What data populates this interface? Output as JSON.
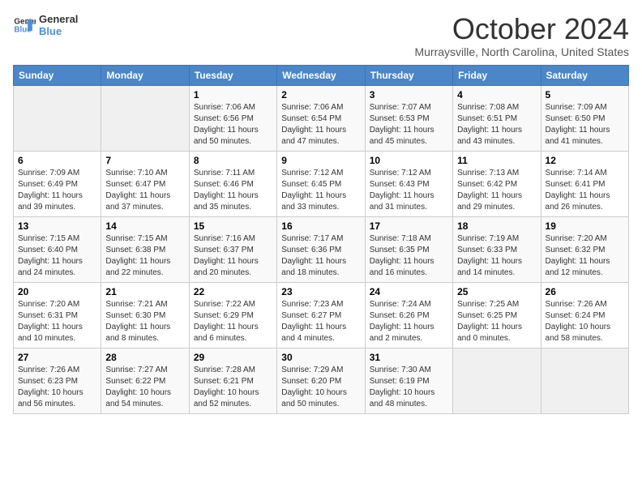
{
  "logo": {
    "line1": "General",
    "line2": "Blue"
  },
  "title": "October 2024",
  "location": "Murraysville, North Carolina, United States",
  "days_of_week": [
    "Sunday",
    "Monday",
    "Tuesday",
    "Wednesday",
    "Thursday",
    "Friday",
    "Saturday"
  ],
  "weeks": [
    [
      {
        "day": "",
        "empty": true
      },
      {
        "day": "",
        "empty": true
      },
      {
        "day": "1",
        "sunrise": "Sunrise: 7:06 AM",
        "sunset": "Sunset: 6:56 PM",
        "daylight": "Daylight: 11 hours and 50 minutes."
      },
      {
        "day": "2",
        "sunrise": "Sunrise: 7:06 AM",
        "sunset": "Sunset: 6:54 PM",
        "daylight": "Daylight: 11 hours and 47 minutes."
      },
      {
        "day": "3",
        "sunrise": "Sunrise: 7:07 AM",
        "sunset": "Sunset: 6:53 PM",
        "daylight": "Daylight: 11 hours and 45 minutes."
      },
      {
        "day": "4",
        "sunrise": "Sunrise: 7:08 AM",
        "sunset": "Sunset: 6:51 PM",
        "daylight": "Daylight: 11 hours and 43 minutes."
      },
      {
        "day": "5",
        "sunrise": "Sunrise: 7:09 AM",
        "sunset": "Sunset: 6:50 PM",
        "daylight": "Daylight: 11 hours and 41 minutes."
      }
    ],
    [
      {
        "day": "6",
        "sunrise": "Sunrise: 7:09 AM",
        "sunset": "Sunset: 6:49 PM",
        "daylight": "Daylight: 11 hours and 39 minutes."
      },
      {
        "day": "7",
        "sunrise": "Sunrise: 7:10 AM",
        "sunset": "Sunset: 6:47 PM",
        "daylight": "Daylight: 11 hours and 37 minutes."
      },
      {
        "day": "8",
        "sunrise": "Sunrise: 7:11 AM",
        "sunset": "Sunset: 6:46 PM",
        "daylight": "Daylight: 11 hours and 35 minutes."
      },
      {
        "day": "9",
        "sunrise": "Sunrise: 7:12 AM",
        "sunset": "Sunset: 6:45 PM",
        "daylight": "Daylight: 11 hours and 33 minutes."
      },
      {
        "day": "10",
        "sunrise": "Sunrise: 7:12 AM",
        "sunset": "Sunset: 6:43 PM",
        "daylight": "Daylight: 11 hours and 31 minutes."
      },
      {
        "day": "11",
        "sunrise": "Sunrise: 7:13 AM",
        "sunset": "Sunset: 6:42 PM",
        "daylight": "Daylight: 11 hours and 29 minutes."
      },
      {
        "day": "12",
        "sunrise": "Sunrise: 7:14 AM",
        "sunset": "Sunset: 6:41 PM",
        "daylight": "Daylight: 11 hours and 26 minutes."
      }
    ],
    [
      {
        "day": "13",
        "sunrise": "Sunrise: 7:15 AM",
        "sunset": "Sunset: 6:40 PM",
        "daylight": "Daylight: 11 hours and 24 minutes."
      },
      {
        "day": "14",
        "sunrise": "Sunrise: 7:15 AM",
        "sunset": "Sunset: 6:38 PM",
        "daylight": "Daylight: 11 hours and 22 minutes."
      },
      {
        "day": "15",
        "sunrise": "Sunrise: 7:16 AM",
        "sunset": "Sunset: 6:37 PM",
        "daylight": "Daylight: 11 hours and 20 minutes."
      },
      {
        "day": "16",
        "sunrise": "Sunrise: 7:17 AM",
        "sunset": "Sunset: 6:36 PM",
        "daylight": "Daylight: 11 hours and 18 minutes."
      },
      {
        "day": "17",
        "sunrise": "Sunrise: 7:18 AM",
        "sunset": "Sunset: 6:35 PM",
        "daylight": "Daylight: 11 hours and 16 minutes."
      },
      {
        "day": "18",
        "sunrise": "Sunrise: 7:19 AM",
        "sunset": "Sunset: 6:33 PM",
        "daylight": "Daylight: 11 hours and 14 minutes."
      },
      {
        "day": "19",
        "sunrise": "Sunrise: 7:20 AM",
        "sunset": "Sunset: 6:32 PM",
        "daylight": "Daylight: 11 hours and 12 minutes."
      }
    ],
    [
      {
        "day": "20",
        "sunrise": "Sunrise: 7:20 AM",
        "sunset": "Sunset: 6:31 PM",
        "daylight": "Daylight: 11 hours and 10 minutes."
      },
      {
        "day": "21",
        "sunrise": "Sunrise: 7:21 AM",
        "sunset": "Sunset: 6:30 PM",
        "daylight": "Daylight: 11 hours and 8 minutes."
      },
      {
        "day": "22",
        "sunrise": "Sunrise: 7:22 AM",
        "sunset": "Sunset: 6:29 PM",
        "daylight": "Daylight: 11 hours and 6 minutes."
      },
      {
        "day": "23",
        "sunrise": "Sunrise: 7:23 AM",
        "sunset": "Sunset: 6:27 PM",
        "daylight": "Daylight: 11 hours and 4 minutes."
      },
      {
        "day": "24",
        "sunrise": "Sunrise: 7:24 AM",
        "sunset": "Sunset: 6:26 PM",
        "daylight": "Daylight: 11 hours and 2 minutes."
      },
      {
        "day": "25",
        "sunrise": "Sunrise: 7:25 AM",
        "sunset": "Sunset: 6:25 PM",
        "daylight": "Daylight: 11 hours and 0 minutes."
      },
      {
        "day": "26",
        "sunrise": "Sunrise: 7:26 AM",
        "sunset": "Sunset: 6:24 PM",
        "daylight": "Daylight: 10 hours and 58 minutes."
      }
    ],
    [
      {
        "day": "27",
        "sunrise": "Sunrise: 7:26 AM",
        "sunset": "Sunset: 6:23 PM",
        "daylight": "Daylight: 10 hours and 56 minutes."
      },
      {
        "day": "28",
        "sunrise": "Sunrise: 7:27 AM",
        "sunset": "Sunset: 6:22 PM",
        "daylight": "Daylight: 10 hours and 54 minutes."
      },
      {
        "day": "29",
        "sunrise": "Sunrise: 7:28 AM",
        "sunset": "Sunset: 6:21 PM",
        "daylight": "Daylight: 10 hours and 52 minutes."
      },
      {
        "day": "30",
        "sunrise": "Sunrise: 7:29 AM",
        "sunset": "Sunset: 6:20 PM",
        "daylight": "Daylight: 10 hours and 50 minutes."
      },
      {
        "day": "31",
        "sunrise": "Sunrise: 7:30 AM",
        "sunset": "Sunset: 6:19 PM",
        "daylight": "Daylight: 10 hours and 48 minutes."
      },
      {
        "day": "",
        "empty": true
      },
      {
        "day": "",
        "empty": true
      }
    ]
  ]
}
